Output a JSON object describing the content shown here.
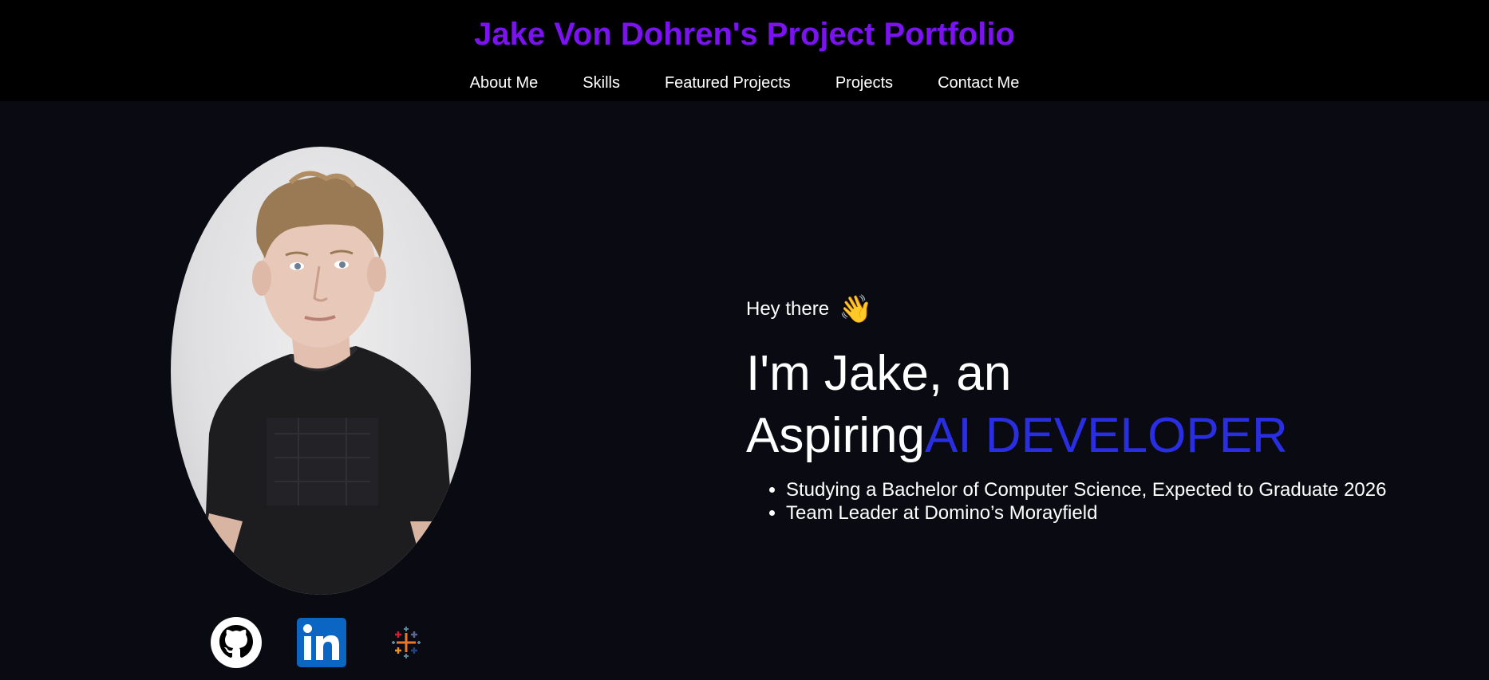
{
  "header": {
    "title": "Jake Von Dohren's Project Portfolio",
    "nav": [
      "About Me",
      "Skills",
      "Featured Projects",
      "Projects",
      "Contact Me"
    ]
  },
  "profile": {
    "photo": "portrait-photo"
  },
  "social": {
    "icons": [
      "github-icon",
      "linkedin-icon",
      "tableau-icon"
    ]
  },
  "intro": {
    "greeting": "Hey there",
    "wave": "👋",
    "headline_line1": "I'm Jake, an",
    "headline_prefix": "Aspiring",
    "headline_role": "AI DEVELOPER",
    "bullets": [
      "Studying a Bachelor of Computer Science, Expected to Graduate 2026",
      "Team Leader at Domino’s Morayfield"
    ]
  },
  "colors": {
    "title": "#7b12f0",
    "role": "#2a2ee3",
    "background": "#0a0b12",
    "header_bg": "#000000"
  }
}
